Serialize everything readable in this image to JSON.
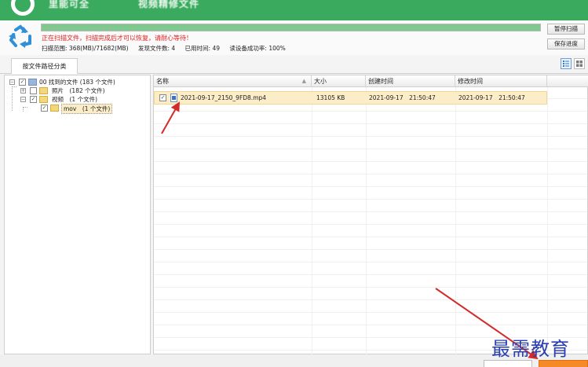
{
  "window": {
    "title_left": "里能可全",
    "title_right": "视频精修文件"
  },
  "scan": {
    "progress": 1.0,
    "warning": "正在扫描文件，扫描完成后才可以恢复，请耐心等待！",
    "range_label": "扫描范围:",
    "range_value": "368(MB)/71682(MB)",
    "found_label": "发现文件数:",
    "found_value": "4",
    "time_label": "已用时间:",
    "time_value": "49",
    "read_label": "读设备成功率:",
    "read_value": "100%"
  },
  "buttons": {
    "pause": "暂停扫描",
    "save": "保存进度"
  },
  "tabs": {
    "by_path": "按文件路径分类"
  },
  "tree": {
    "root": "00 找到的文件 (183 个文件)",
    "photos": "照片　(182 个文件)",
    "videos": "视频　(1 个文件)",
    "mov": "mov　(1 个文件)",
    "check_mark": "✓",
    "minus": "−",
    "plus": "+"
  },
  "table": {
    "columns": [
      "名称",
      "大小",
      "创建时间",
      "修改时间"
    ],
    "sort_glyph": "▲",
    "rows": [
      {
        "checked": "✓",
        "name": "2021-09-17_2150_9FD8.mp4",
        "size": "13105 KB",
        "created": "2021-09-17　21:50:47",
        "modified": "2021-09-17　21:50:47"
      }
    ]
  },
  "watermark": "最需教育",
  "colors": {
    "title_green": "#3aab5e",
    "warning_red": "#e02020",
    "selection": "#fcedc9",
    "annotation_red": "#d32a2a",
    "accent_orange": "#f58a27"
  }
}
